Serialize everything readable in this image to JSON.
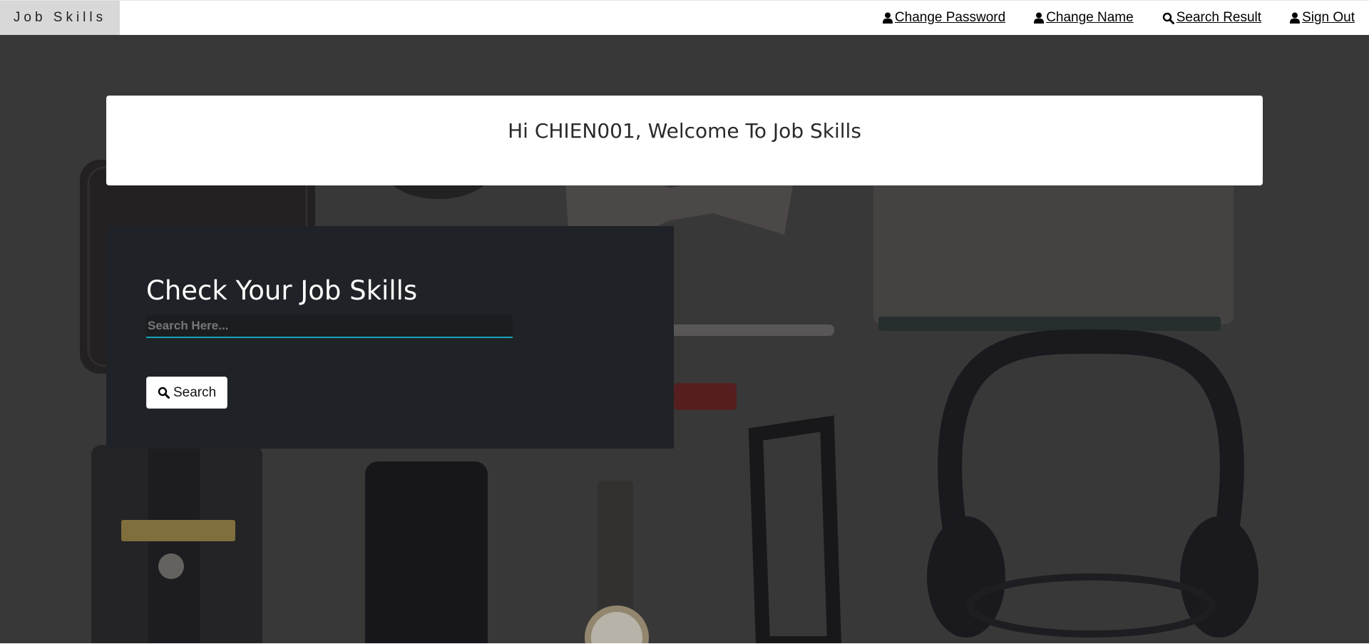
{
  "brand": "Job Skills",
  "nav": [
    {
      "label": "Change Password",
      "icon": "user-icon"
    },
    {
      "label": "Change Name",
      "icon": "user-icon"
    },
    {
      "label": "Search Result",
      "icon": "search-icon"
    },
    {
      "label": "Sign Out",
      "icon": "user-icon"
    }
  ],
  "welcome": "Hi CHIEN001, Welcome To Job Skills",
  "search": {
    "title": "Check Your Job Skills",
    "placeholder": "Search Here...",
    "value": "",
    "button_label": "Search",
    "button_icon": "search-icon"
  },
  "colors": {
    "accent": "#17a2b8",
    "panel": "#1f2226",
    "background": "#444241",
    "brand_bg": "#d8d8d8"
  }
}
